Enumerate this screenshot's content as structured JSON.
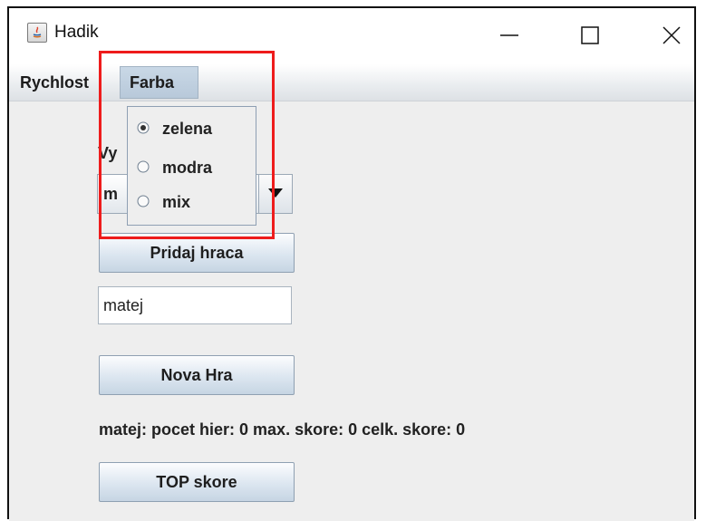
{
  "window": {
    "title": "Hadik",
    "icon": "java-icon",
    "controls": [
      "minimize-icon",
      "maximize-icon",
      "close-icon"
    ]
  },
  "menubar": {
    "items": [
      {
        "label": "Rychlost"
      },
      {
        "label": "Farba"
      }
    ]
  },
  "farba_menu": {
    "options": [
      {
        "label": "zelena",
        "selected": true
      },
      {
        "label": "modra",
        "selected": false
      },
      {
        "label": "mix",
        "selected": false
      }
    ]
  },
  "form": {
    "select_label_partial": "Vy",
    "combo_value_partial": "m",
    "add_player_button": "Pridaj hraca",
    "player_name_value": "matej",
    "new_game_button": "Nova Hra",
    "stats_text": "matej: pocet hier: 0 max. skore: 0 celk. skore: 0",
    "top_score_button": "TOP skore"
  },
  "colors": {
    "highlight": "#ee1c1c",
    "menu_selected_bg": "#b8c9da",
    "window_bg": "#eeeeee"
  }
}
